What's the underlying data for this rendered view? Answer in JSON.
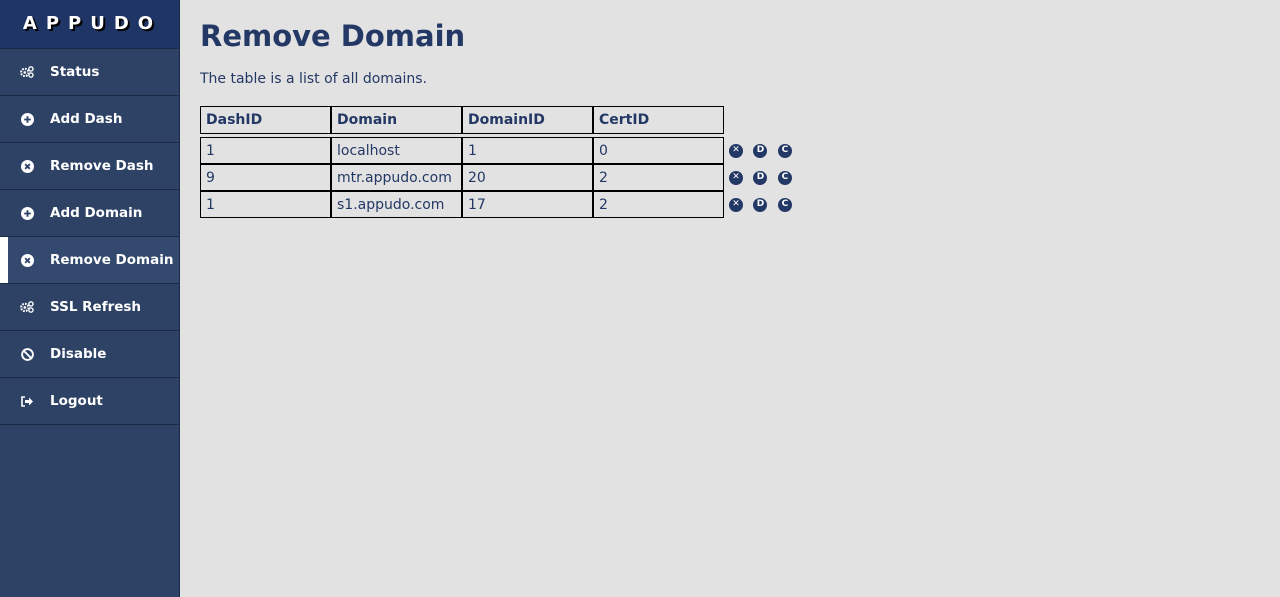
{
  "brand": "APPUDO",
  "nav": [
    {
      "label": "Status",
      "icon": "gears-icon",
      "active": false
    },
    {
      "label": "Add Dash",
      "icon": "plus-circle-icon",
      "active": false
    },
    {
      "label": "Remove Dash",
      "icon": "x-circle-icon",
      "active": false
    },
    {
      "label": "Add Domain",
      "icon": "plus-circle-icon",
      "active": false
    },
    {
      "label": "Remove Domain",
      "icon": "x-circle-icon",
      "active": true
    },
    {
      "label": "SSL Refresh",
      "icon": "gears-icon",
      "active": false
    },
    {
      "label": "Disable",
      "icon": "ban-icon",
      "active": false
    },
    {
      "label": "Logout",
      "icon": "sign-out-icon",
      "active": false
    }
  ],
  "page": {
    "title": "Remove Domain",
    "description": "The table is a list of all domains."
  },
  "table": {
    "headers": [
      "DashID",
      "Domain",
      "DomainID",
      "CertID"
    ],
    "rows": [
      [
        "1",
        "localhost",
        "1",
        "0"
      ],
      [
        "9",
        "mtr.appudo.com",
        "20",
        "2"
      ],
      [
        "1",
        "s1.appudo.com",
        "17",
        "2"
      ]
    ],
    "actions": [
      {
        "glyph": "✕",
        "name": "remove-action-icon"
      },
      {
        "glyph": "D",
        "name": "dash-action-icon"
      },
      {
        "glyph": "C",
        "name": "cert-action-icon"
      }
    ]
  },
  "colors": {
    "sidebar": "#2e4266",
    "brand_bar": "#1f3566",
    "accent_text": "#233865",
    "background": "#e2e2e2"
  }
}
